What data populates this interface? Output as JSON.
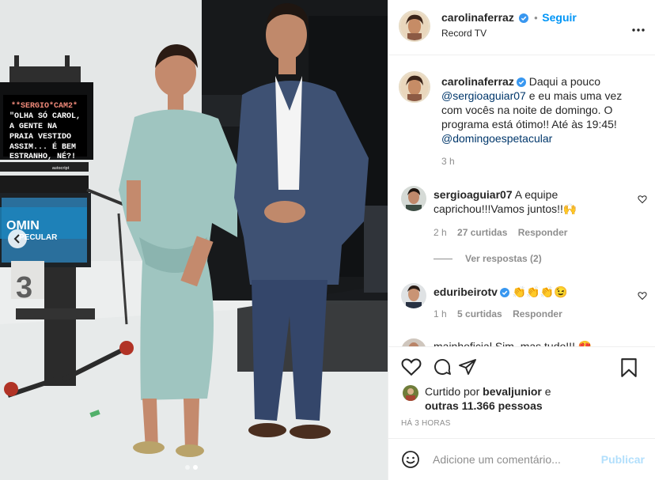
{
  "post": {
    "author": "carolinaferraz",
    "follow_label": "Seguir",
    "separator": "•",
    "location": "Record TV",
    "caption_author": "carolinaferraz",
    "caption_parts": [
      "Daqui a pouco",
      "@sergioaguiar07",
      "e eu mais uma vez",
      "com vocês na noite de domingo. O",
      "programa está ótimo!! Até às 19:45!",
      "@domingoespetacular"
    ],
    "caption_time": "3 h"
  },
  "photo": {
    "teleprompter_lines": [
      "**SERGIO*CAM2*",
      "\"OLHA SÓ CAROL,",
      "A GENTE NA",
      "PRAIA VESTIDO",
      "ASSIM... É BEM",
      "ESTRANHO, NÉ?!"
    ],
    "screen_text": [
      "OMIN",
      "PECULAR"
    ],
    "camera_number": "3",
    "brand_small": "autocript"
  },
  "comments": [
    {
      "author": "sergioaguiar07",
      "text_line1": "A equipe",
      "text_line2": "caprichou!!!Vamos juntos!!🙌",
      "time": "2 h",
      "likes": "27 curtidas",
      "reply": "Responder",
      "view_replies": "Ver respostas (2)"
    },
    {
      "author": "eduribeirotv",
      "text": "👏👏👏😉",
      "time": "1 h",
      "likes": "5 curtidas",
      "reply": "Responder"
    }
  ],
  "partial_comment": "mainhoficial  Sim, mas tudo!!! 😍",
  "likes": {
    "prefix": "Curtido por",
    "user": "bevaljunior",
    "connector": "e",
    "others": "outras 11.366 pessoas"
  },
  "time_ago": "HÁ 3 HORAS",
  "composer": {
    "placeholder": "Adicione um comentário...",
    "publish_label": "Publicar"
  },
  "colors": {
    "accent": "#0095f6",
    "verified": "#3897f0",
    "dress": "#9fc5c0",
    "suit": "#3e5173"
  }
}
